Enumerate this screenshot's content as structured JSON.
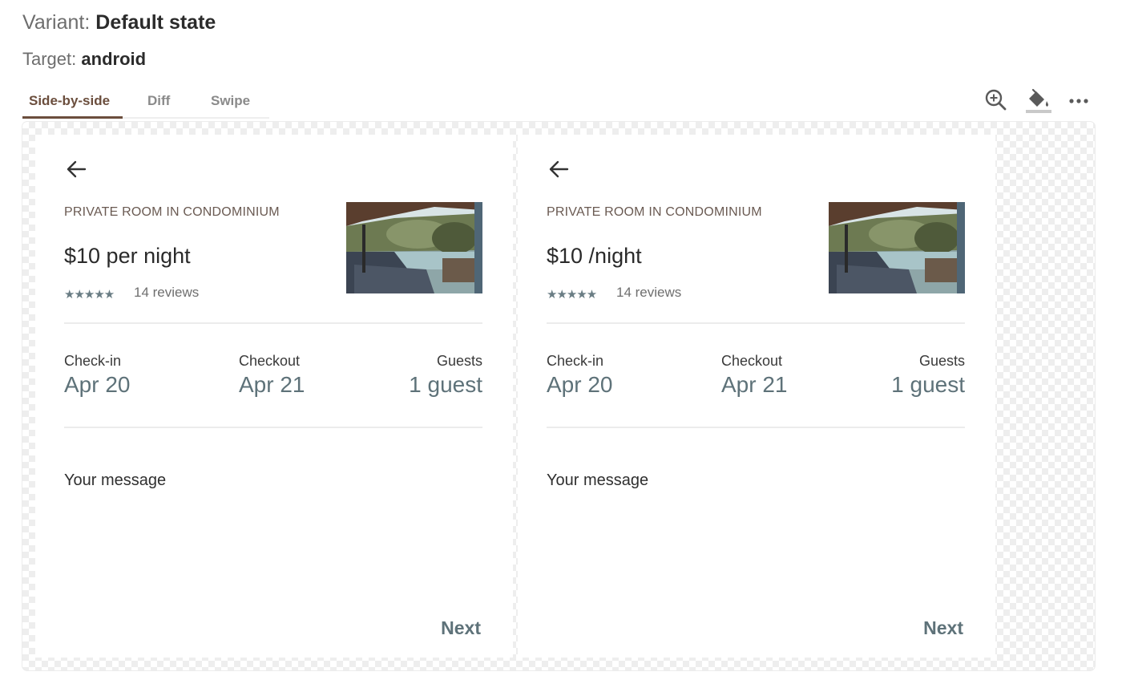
{
  "header": {
    "variant_label": "Variant:",
    "variant_value": "Default state",
    "target_label": "Target:",
    "target_value": "android"
  },
  "tabs": [
    {
      "label": "Side-by-side",
      "active": true
    },
    {
      "label": "Diff",
      "active": false
    },
    {
      "label": "Swipe",
      "active": false
    }
  ],
  "toolbar": {
    "icons": [
      "zoom-in-icon",
      "paint-bucket-icon",
      "more-icon"
    ]
  },
  "colors": {
    "accent_brown": "#6b4e3d",
    "value_slate": "#5e7279"
  },
  "panels": [
    {
      "room_type": "PRIVATE ROOM IN CONDOMINIUM",
      "price": "$10 per night",
      "stars": "★★★★★",
      "reviews": "14 reviews",
      "checkin_label": "Check-in",
      "checkin_value": "Apr 20",
      "checkout_label": "Checkout",
      "checkout_value": "Apr 21",
      "guests_label": "Guests",
      "guests_value": "1 guest",
      "message_label": "Your message",
      "next_label": "Next"
    },
    {
      "room_type": "PRIVATE ROOM IN CONDOMINIUM",
      "price": "$10 /night",
      "stars": "★★★★★",
      "reviews": "14 reviews",
      "checkin_label": "Check-in",
      "checkin_value": "Apr 20",
      "checkout_label": "Checkout",
      "checkout_value": "Apr 21",
      "guests_label": "Guests",
      "guests_value": "1 guest",
      "message_label": "Your message",
      "next_label": "Next"
    }
  ]
}
